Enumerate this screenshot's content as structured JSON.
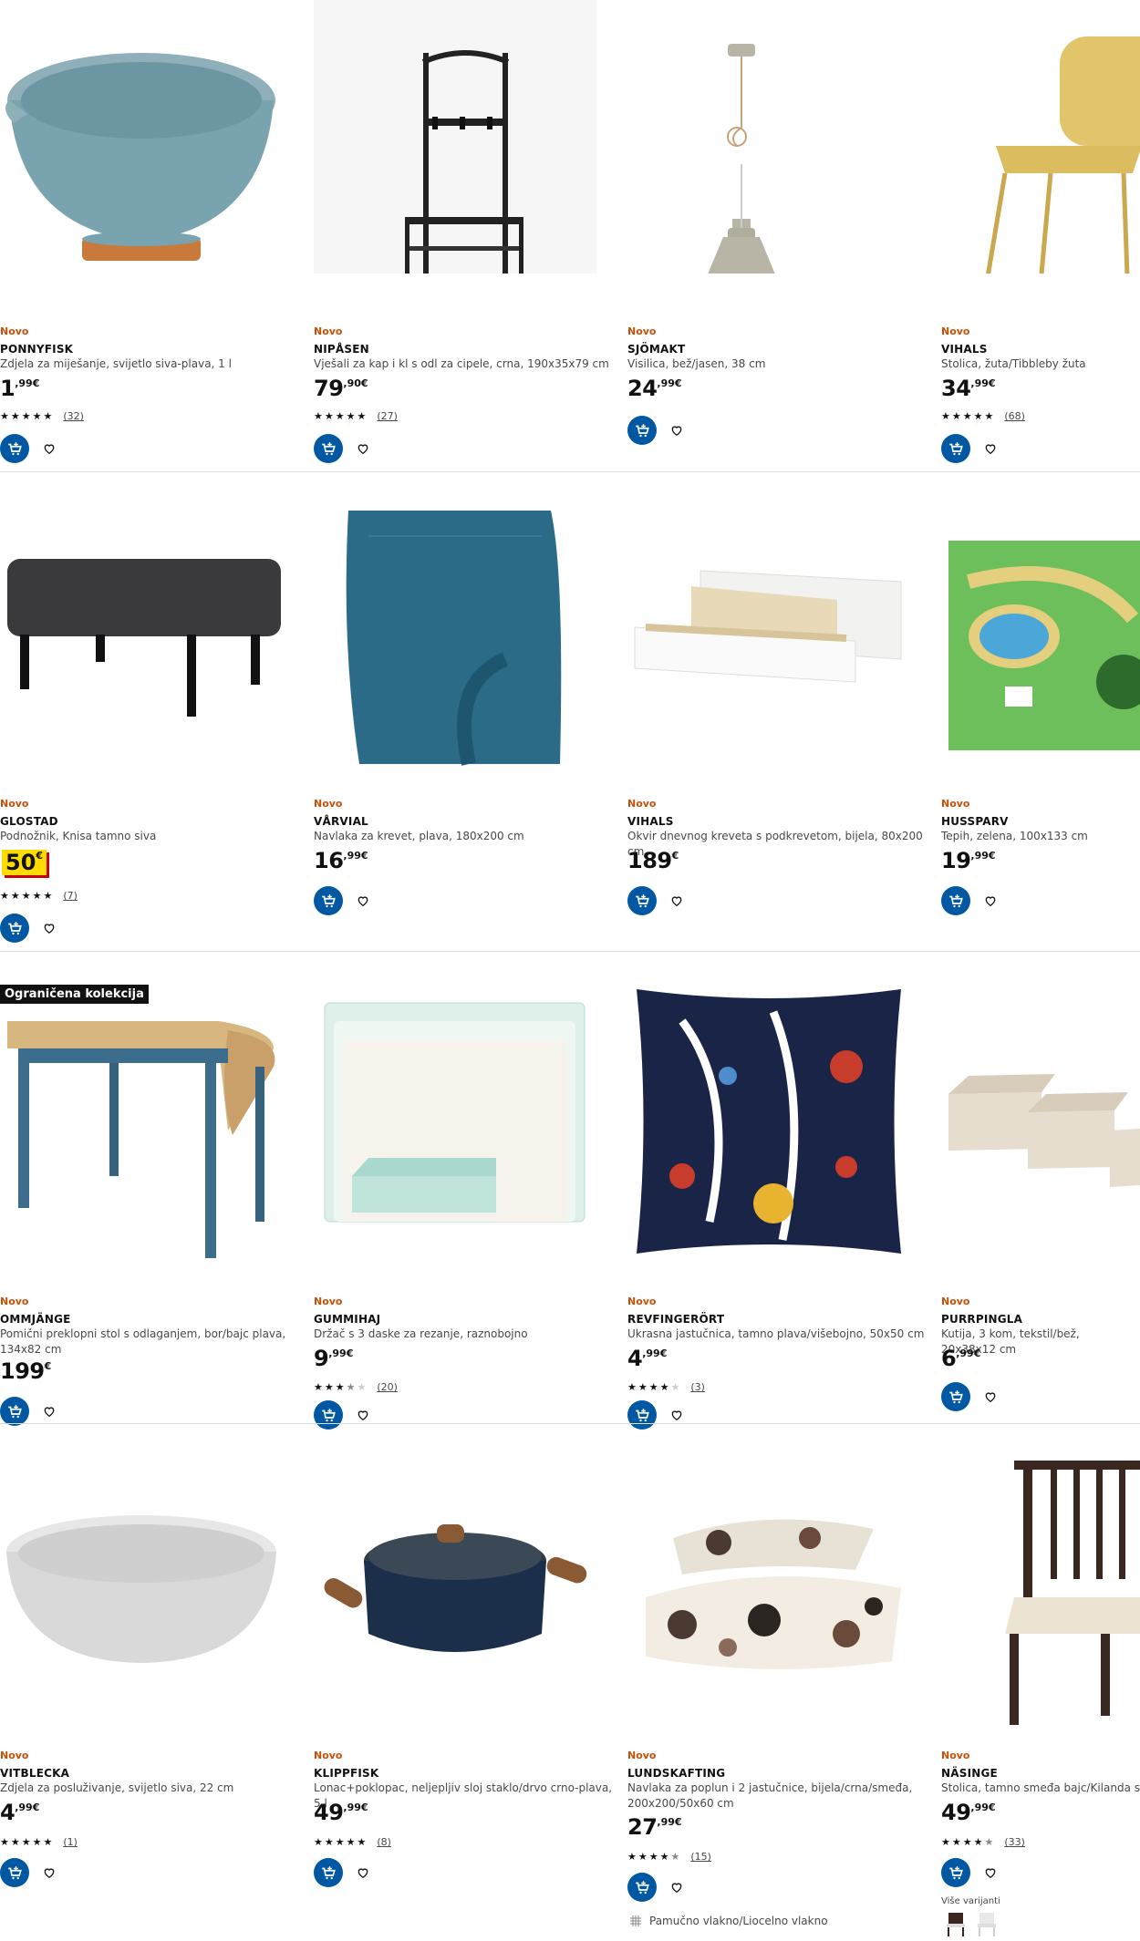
{
  "labels": {
    "new": "Novo",
    "limited_collection": "Ograničena kolekcija",
    "more_variants": "Više varijanti",
    "currency": "€"
  },
  "products": [
    {
      "badge": "Novo",
      "name": "PONNYFISK",
      "desc": "Zdjela za miješanje, svijetlo siva-plava, 1 l",
      "price_int": "1",
      "price_dec": ",99€",
      "stars": 5,
      "reviews": "(32)"
    },
    {
      "badge": "Novo",
      "name": "NIPÅSEN",
      "desc": "Vješali za kap i kl s odl za cipele, crna, 190x35x79 cm",
      "price_int": "79",
      "price_dec": ",90€",
      "stars": 5,
      "reviews": "(27)"
    },
    {
      "badge": "Novo",
      "name": "SJÖMAKT",
      "desc": "Visilica, bež/jasen, 38 cm",
      "price_int": "24",
      "price_dec": ",99€"
    },
    {
      "badge": "Novo",
      "name": "VIHALS",
      "desc": "Stolica, žuta/Tibbleby žuta",
      "price_int": "34",
      "price_dec": ",99€",
      "stars": 5,
      "reviews": "(68)"
    },
    {
      "badge": "Novo",
      "name": "GLOSTAD",
      "desc": "Podnožnik, Knisa tamno siva",
      "price_int": "50",
      "price_dec": "€",
      "highlight": true,
      "stars": 5,
      "reviews": "(7)"
    },
    {
      "badge": "Novo",
      "name": "VÅRVIAL",
      "desc": "Navlaka za krevet, plava, 180x200 cm",
      "price_int": "16",
      "price_dec": ",99€"
    },
    {
      "badge": "Novo",
      "name": "VIHALS",
      "desc": "Okvir dnevnog kreveta s podkrevetom, bijela, 80x200 cm",
      "price_int": "189",
      "price_dec": "€"
    },
    {
      "badge": "Novo",
      "name": "HUSSPARV",
      "desc": "Tepih, zelena, 100x133 cm",
      "price_int": "19",
      "price_dec": ",99€"
    },
    {
      "badge": "Novo",
      "name": "OMMJÄNGE",
      "desc": "Pomični preklopni stol s odlaganjem, bor/bajc plava, 134x82 cm",
      "price_int": "199",
      "price_dec": "€",
      "collection": "Ograničena kolekcija"
    },
    {
      "badge": "Novo",
      "name": "GUMMIHAJ",
      "desc": "Držač s 3 daske za rezanje, raznobojno",
      "price_int": "9",
      "price_dec": ",99€",
      "stars": 3.5,
      "reviews": "(20)"
    },
    {
      "badge": "Novo",
      "name": "REVFINGERÖRT",
      "desc": "Ukrasna jastučnica, tamno plava/višebojno, 50x50 cm",
      "price_int": "4",
      "price_dec": ",99€",
      "stars": 4,
      "reviews": "(3)"
    },
    {
      "badge": "Novo",
      "name": "PURRPINGLA",
      "desc": "Kutija, 3 kom, tekstil/bež, 20x38x12 cm",
      "price_int": "6",
      "price_dec": ",99€"
    },
    {
      "badge": "Novo",
      "name": "VITBLECKA",
      "desc": "Zdjela za posluživanje, svijetlo siva, 22 cm",
      "price_int": "4",
      "price_dec": ",99€",
      "stars": 5,
      "reviews": "(1)"
    },
    {
      "badge": "Novo",
      "name": "KLIPPFISK",
      "desc": "Lonac+poklopac, neljepljiv sloj staklo/drvo crno-plava, 5 l",
      "price_int": "49",
      "price_dec": ",99€",
      "stars": 5,
      "reviews": "(8)"
    },
    {
      "badge": "Novo",
      "name": "LUNDSKAFTING",
      "desc": "Navlaka za poplun i 2 jastučnice, bijela/crna/smeđa, 200x200/50x60 cm",
      "price_int": "27",
      "price_dec": ",99€",
      "stars": 4.5,
      "reviews": "(15)",
      "material": "Pamučno vlakno/Liocelno vlakno"
    },
    {
      "badge": "Novo",
      "name": "NÄSINGE",
      "desc": "Stolica, tamno smeđa bajc/Kilanda svijetlo",
      "price_int": "49",
      "price_dec": ",99€",
      "stars": 4.5,
      "reviews": "(33)",
      "more_variants": "Više varijanti"
    }
  ]
}
